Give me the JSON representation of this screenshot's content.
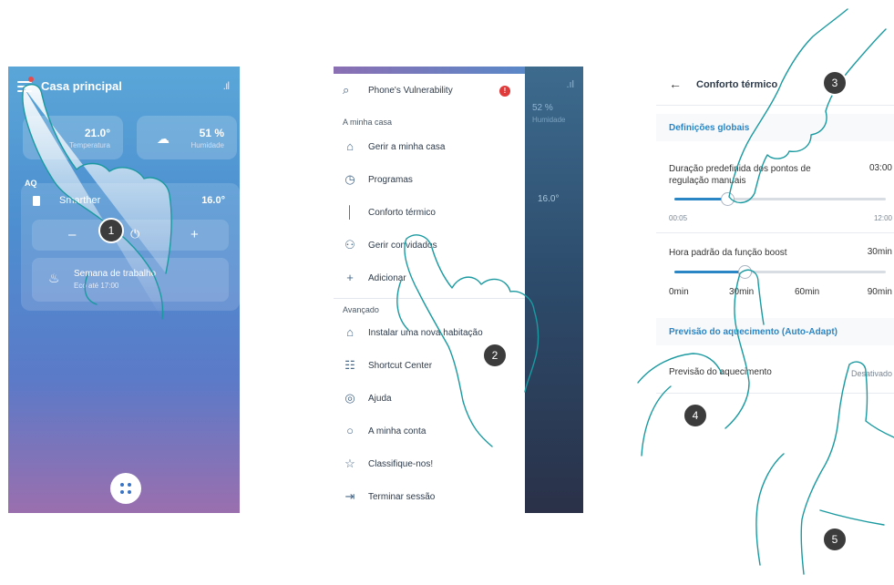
{
  "screen1": {
    "title": "Casa principal",
    "temperature": {
      "value": "21.0°",
      "label": "Temperatura"
    },
    "humidity": {
      "value": "51 %",
      "label": "Humidade"
    },
    "section_label": "AQ",
    "device": {
      "name": "Smarther",
      "temperature": "16.0°"
    },
    "controls": {
      "minus": "–",
      "plus": "+"
    },
    "mode": {
      "name": "Semana de trabalho",
      "detail": "Eco até 17:00"
    }
  },
  "screen2": {
    "vulnerability": {
      "label": "Phone's Vulnerability",
      "badge": "!"
    },
    "sections": {
      "home": "A minha casa",
      "advanced": "Avançado"
    },
    "home_items": [
      {
        "label": "Gerir a minha casa",
        "icon": "home-icon"
      },
      {
        "label": "Programas",
        "icon": "clock-icon"
      },
      {
        "label": "Conforto térmico",
        "icon": "thermometer-icon"
      },
      {
        "label": "Gerir convidados",
        "icon": "users-icon"
      },
      {
        "label": "Adicionar",
        "icon": "plus-icon"
      }
    ],
    "advanced_items": [
      {
        "label": "Instalar uma nova habitação",
        "icon": "new-home-icon"
      },
      {
        "label": "Shortcut Center",
        "icon": "shortcut-icon"
      },
      {
        "label": "Ajuda",
        "icon": "help-icon"
      },
      {
        "label": "A minha conta",
        "icon": "account-icon"
      },
      {
        "label": "Classifique-nos!",
        "icon": "star-icon"
      },
      {
        "label": "Terminar sessão",
        "icon": "logout-icon"
      }
    ],
    "background": {
      "value": "52 %",
      "label": "Humidade",
      "temperature": "16.0°"
    }
  },
  "screen3": {
    "title": "Conforto térmico",
    "section_global": "Definições globais",
    "duration_label": "Duração predefinida dos pontos de regulação manuais",
    "duration_value": "03:00",
    "duration_min": "00:05",
    "duration_max": "12:00",
    "duration_fraction": 0.25,
    "boost_label": "Hora padrão da função boost",
    "boost_value": "30min",
    "boost_ticks": [
      "0min",
      "30min",
      "60min",
      "90min"
    ],
    "boost_fraction": 0.33,
    "section_forecast": "Previsão do aquecimento (Auto-Adapt)",
    "forecast_label": "Previsão do aquecimento",
    "forecast_value": "Desativado"
  },
  "steps": [
    "1",
    "2",
    "3",
    "4",
    "5"
  ],
  "colors": {
    "accent": "#2a86c4",
    "hand_outline": "#1a9aa0",
    "badge": "#3c3c3c",
    "alert": "#e03a3a"
  }
}
